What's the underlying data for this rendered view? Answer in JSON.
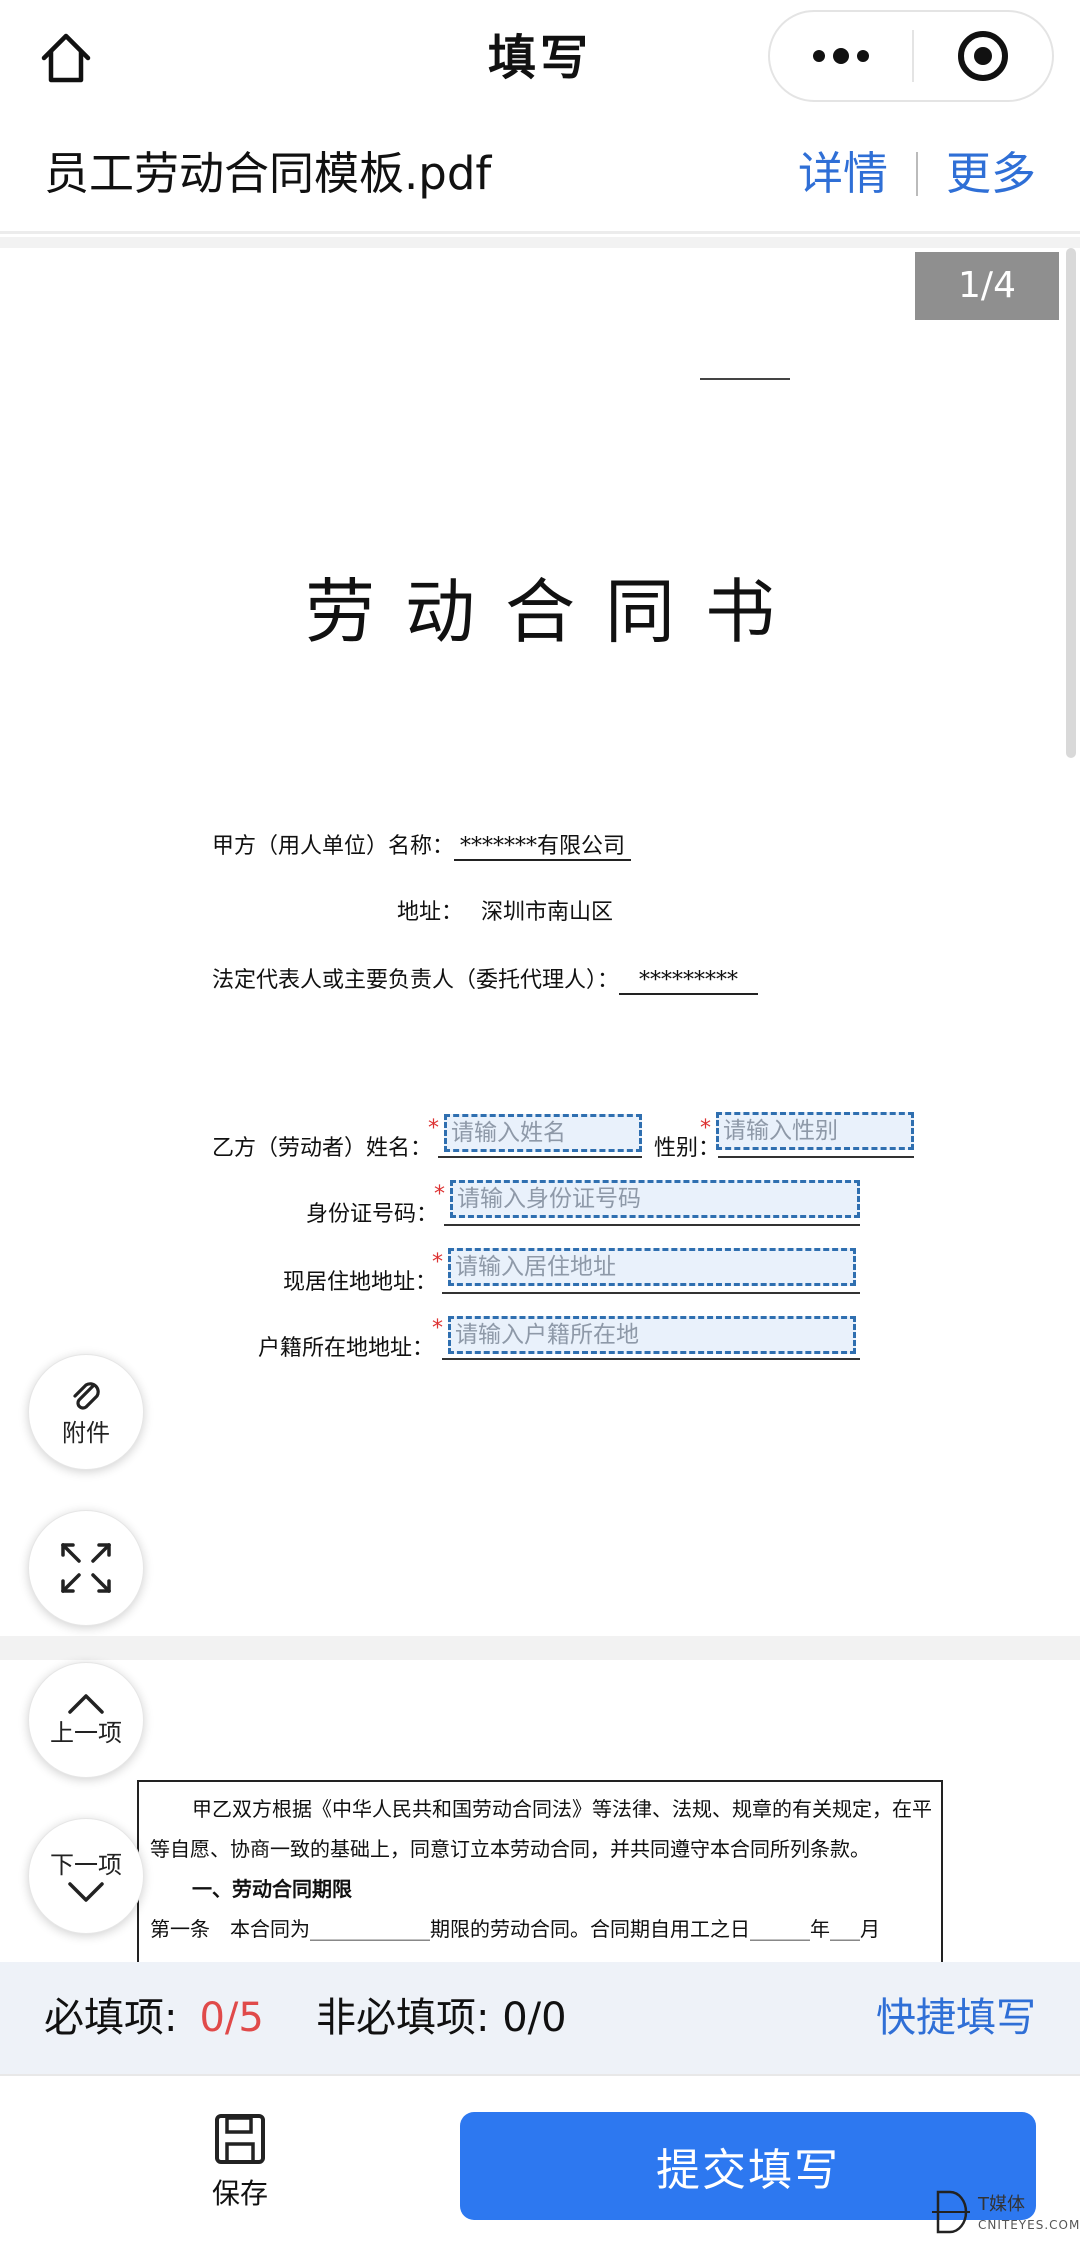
{
  "nav": {
    "title": "填写",
    "home_icon": "home-icon",
    "menu_icon": "more-dots-icon",
    "close_icon": "target-icon"
  },
  "file": {
    "name": "员工劳动合同模板.pdf",
    "details": "详情",
    "more": "更多"
  },
  "page_indicator": "1/4",
  "contract": {
    "title": "劳动合同书",
    "party_a_label": "甲方（用人单位）名称：",
    "party_a_name": "*******有限公司",
    "address_label": "地址：",
    "address_value": "深圳市南山区",
    "rep_label": "法定代表人或主要负责人（委托代理人）：",
    "rep_value": "*********"
  },
  "form": {
    "name_label": "乙方（劳动者）姓名：",
    "name_placeholder": "请输入姓名",
    "gender_label": "性别：",
    "gender_placeholder": "请输入性别",
    "id_label": "身份证号码：",
    "id_placeholder": "请输入身份证号码",
    "residence_label": "现居住地地址：",
    "residence_placeholder": "请输入居住地址",
    "hukou_label": "户籍所在地地址：",
    "hukou_placeholder": "请输入户籍所在地",
    "required_mark": "*"
  },
  "page2": {
    "line1": "甲乙双方根据《中华人民共和国劳动合同法》等法律、法规、规章的有关规定，在平",
    "line2": "等自愿、协商一致的基础上，同意订立本劳动合同，并共同遵守本合同所列条款。",
    "line3": "一、劳动合同期限",
    "line4": "第一条　本合同为____________期限的劳动合同。合同期自用工之日______年___月"
  },
  "fabs": {
    "attach": "附件",
    "expand_icon": "expand-icon",
    "prev": "上一项",
    "next": "下一项"
  },
  "status": {
    "required_label": "必填项:",
    "required_count": "0/5",
    "optional_label": "非必填项: 0/0",
    "quick_fill": "快捷填写"
  },
  "bottom": {
    "save": "保存",
    "submit": "提交填写"
  },
  "watermark": {
    "brand": "T媒体",
    "domain": "CNITEYES.COM"
  },
  "colors": {
    "accent": "#2d78f0",
    "link": "#2f6fd6",
    "required": "#e04a4a",
    "field_border": "#2f6fb0"
  }
}
